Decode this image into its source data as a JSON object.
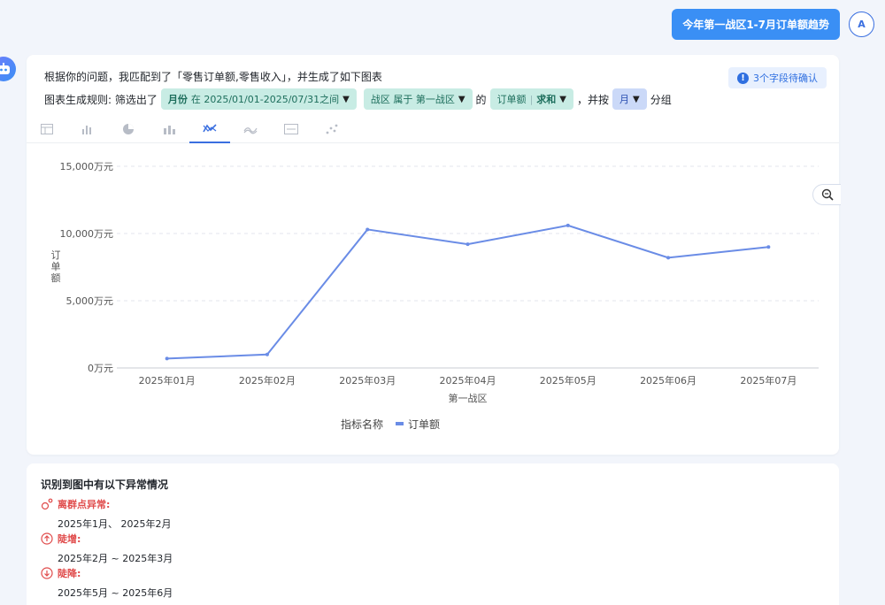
{
  "user_query": "今年第一战区1-7月订单额趋势",
  "user_avatar": "A",
  "intro_text": "根据你的问题，我匹配到了「零售订单额,零售收入」，并生成了如下图表",
  "confirm_badge": "3个字段待确认",
  "rule": {
    "prefix": "图表生成规则: 筛选出了",
    "filter_month_field": "月份",
    "filter_month_text": "在 2025/01/01-2025/07/31之间",
    "filter_zone_text": "战区 属于 第一战区",
    "of_text": "的",
    "metric_field": "订单额",
    "metric_agg": "求和",
    "group_prefix": "，并按",
    "group_value": "月",
    "group_suffix": "分组"
  },
  "tabs": [
    "table-icon",
    "bar-chart-icon",
    "pie-chart-icon",
    "stacked-bar-icon",
    "line-chart-icon",
    "area-chart-icon",
    "number-card-icon",
    "scatter-icon"
  ],
  "active_tab": 4,
  "chart_data": {
    "type": "line",
    "categories": [
      "2025年01月",
      "2025年02月",
      "2025年03月",
      "2025年04月",
      "2025年05月",
      "2025年06月",
      "2025年07月"
    ],
    "series": [
      {
        "name": "订单额",
        "values": [
          700,
          1000,
          10300,
          9200,
          10600,
          8200,
          9000
        ],
        "color": "#6a8ce6"
      }
    ],
    "y_ticks": [
      "0万元",
      "5,000万元",
      "10,000万元",
      "15,000万元"
    ],
    "ylim": [
      0,
      15000
    ],
    "xlabel": "第一战区",
    "ylabel": "订单额",
    "legend_title": "指标名称",
    "grid": true
  },
  "anomaly": {
    "title": "识别到图中有以下异常情况",
    "items": [
      {
        "label": "离群点异常:",
        "value": "2025年1月、 2025年2月",
        "icon": "outlier-icon"
      },
      {
        "label": "陡增:",
        "value": "2025年2月 ~ 2025年3月",
        "icon": "surge-icon"
      },
      {
        "label": "陡降:",
        "value": "2025年5月 ~ 2025年6月",
        "icon": "plunge-icon"
      }
    ]
  }
}
